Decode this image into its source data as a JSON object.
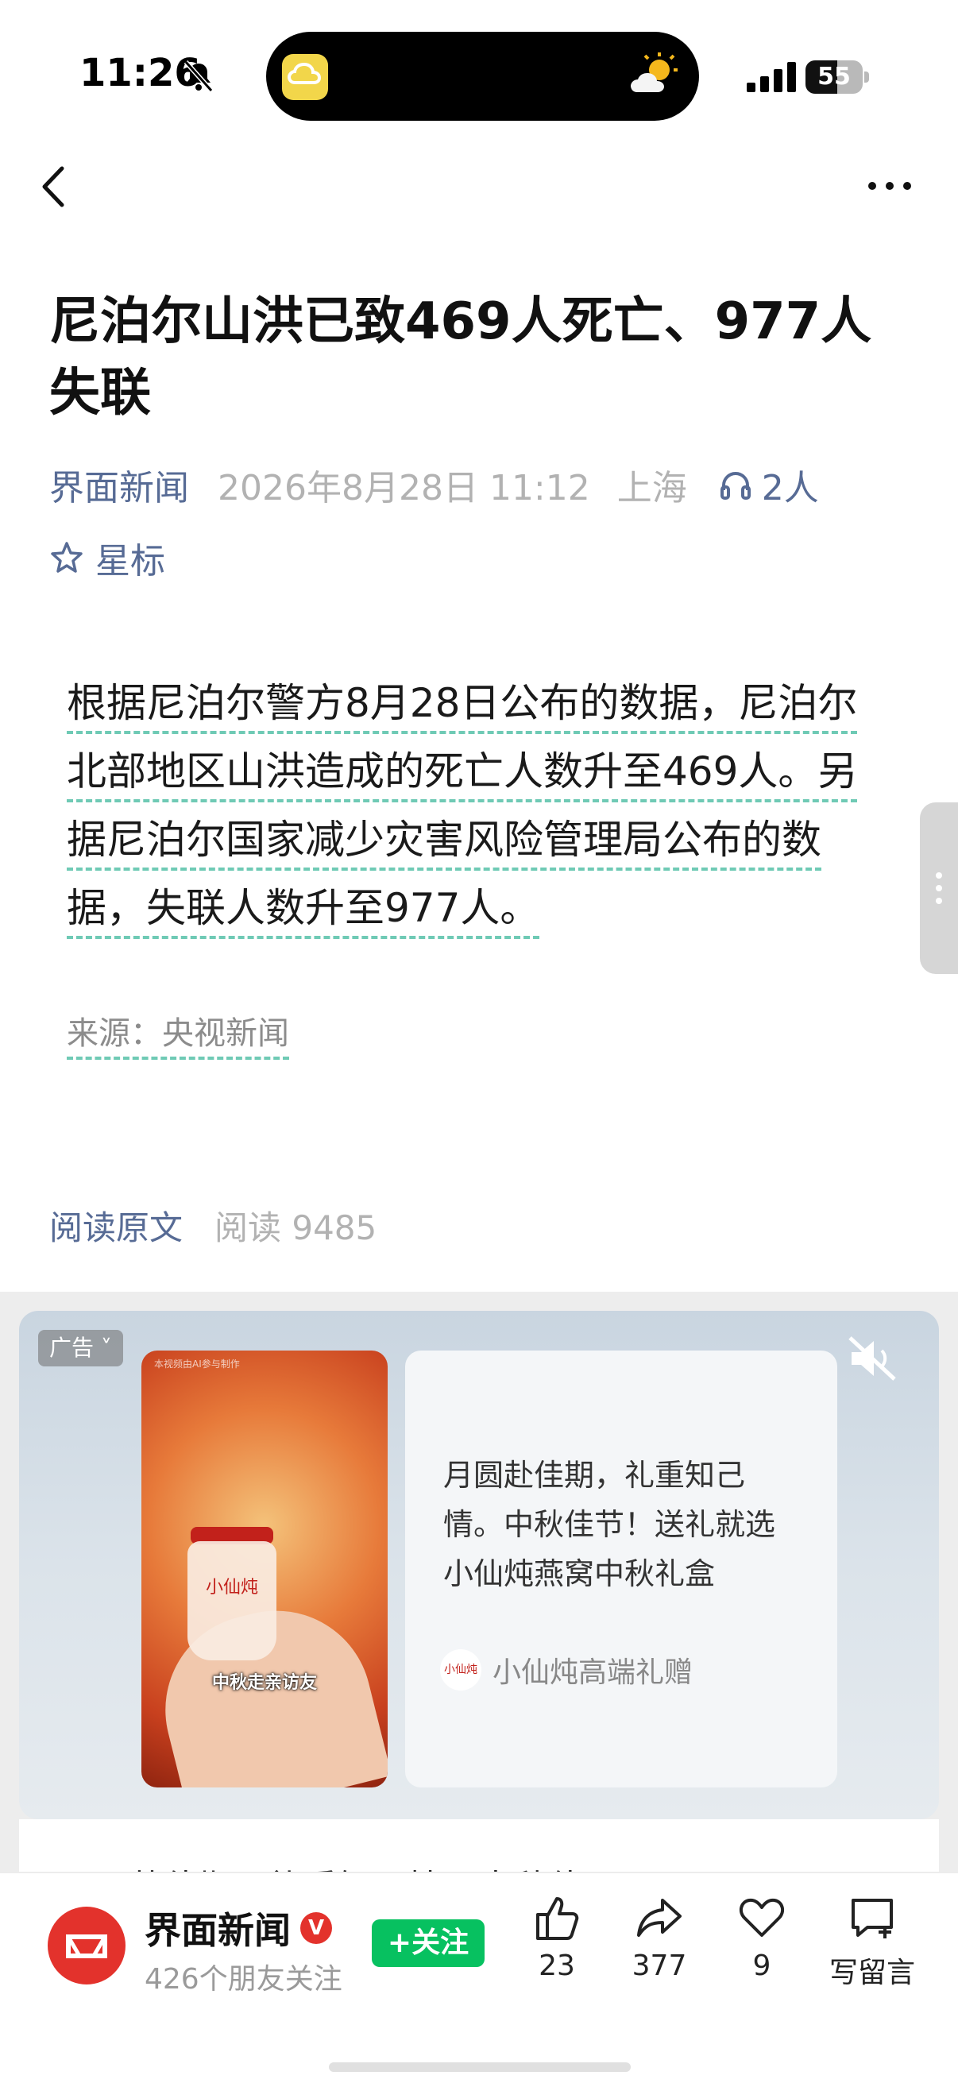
{
  "status_bar": {
    "time": "11:26",
    "battery_text": "55",
    "battery_level": 0.55
  },
  "article": {
    "title": "尼泊尔山洪已致469人死亡、977人失联",
    "source": "界面新闻",
    "date": "2026年8月28日 11:12",
    "location": "上海",
    "listeners": "2人",
    "star_label": "星标",
    "body": "根据尼泊尔警方8月28日公布的数据，尼泊尔北部地区山洪造成的死亡人数升至469人。另据尼泊尔国家减少灾害风险管理局公布的数据，失联人数升至977人。",
    "credit": "来源：央视新闻",
    "read_original": "阅读原文",
    "read_count": "阅读 9485"
  },
  "ad": {
    "tag": "广告",
    "image_caption": "中秋走亲访友",
    "image_top_text": "本视频由AI参与制作",
    "jar_label": "小仙炖",
    "copy": "月圆赴佳期，礼重知己情。中秋佳节！送礼就选小仙炖燕窝中秋礼盒",
    "brand_logo": "小仙炖",
    "brand": "小仙炖高端礼赠",
    "footer_text": "月圆赴佳期，礼重知己情。中秋佳"
  },
  "bottom_bar": {
    "account_name": "界面新闻",
    "verified_mark": "V",
    "followers": "426个朋友关注",
    "follow_label": "+关注",
    "likes": "23",
    "shares": "377",
    "favorites": "9",
    "comment_label": "写留言"
  },
  "colors": {
    "link_blue": "#576b95",
    "follow_green": "#07c160",
    "brand_red": "#e3322c",
    "underline_teal": "#6fcab5"
  },
  "icons": [
    "bell-muted-icon",
    "weather-icon",
    "signal-icon",
    "back-icon",
    "more-icon",
    "headphone-icon",
    "star-icon",
    "mute-icon",
    "like-icon",
    "share-icon",
    "heart-icon",
    "comment-icon"
  ]
}
